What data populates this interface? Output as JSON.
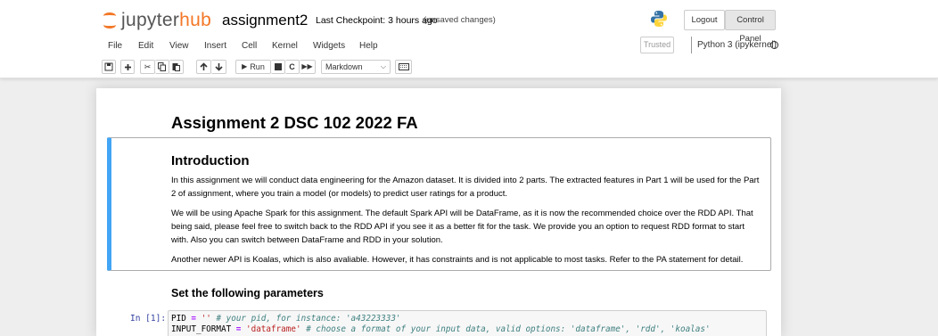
{
  "header": {
    "logo_a": "jupyter",
    "logo_b": "hub",
    "notebook_name": "assignment2",
    "checkpoint": "Last Checkpoint: 3 hours ago",
    "save_status": "(unsaved changes)",
    "logout_label": "Logout",
    "control_panel_label": "Control Panel"
  },
  "menubar": {
    "items": [
      "File",
      "Edit",
      "View",
      "Insert",
      "Cell",
      "Kernel",
      "Widgets",
      "Help"
    ],
    "trusted": "Trusted",
    "kernel": "Python 3 (ipykernel)"
  },
  "toolbar": {
    "run_label": "Run",
    "cell_type": "Markdown",
    "icons": [
      "save-icon",
      "add-icon",
      "cut-icon",
      "copy-icon",
      "paste-icon",
      "move-up-icon",
      "move-down-icon",
      "run-icon",
      "stop-icon",
      "restart-icon",
      "fast-forward-icon",
      "keyboard-icon"
    ]
  },
  "notebook": {
    "title": "Assignment 2 DSC 102 2022 FA",
    "intro_heading": "Introduction",
    "para1_line1": "In this assignment we will conduct data engineering for the Amazon dataset. It is divided into 2 parts. The extracted features in Part 1 will be used for the Part",
    "para1_line2": "2 of assignment, where you train a model (or models) to predict user ratings for a product.",
    "para2_line1": "We will be using Apache Spark for this assignment. The default Spark API will be DataFrame, as it is now the recommended choice over the RDD API. That",
    "para2_line2": "being said, please feel free to switch back to the RDD API if you see it as a better fit for the task. We provide you an option to request RDD format to start",
    "para2_line3": "with. Also you can switch between DataFrame and RDD in your solution.",
    "para3": "Another newer API is Koalas, which is also avaliable. However, it has constraints and is not applicable to most tasks. Refer to the PA statement for detail.",
    "params_heading": "Set the following parameters",
    "prompt": "In [1]:",
    "code": {
      "l1_var": "PID",
      "l1_op": "=",
      "l1_str": "''",
      "l1_comment": "# your pid, for instance: 'a43223333'",
      "l2_var": "INPUT_FORMAT",
      "l2_op": "=",
      "l2_str": "'dataframe'",
      "l2_comment": "# choose a format of your input data, valid options: 'dataframe', 'rdd', 'koalas'"
    }
  },
  "colors": {
    "jupyter_orange": "#f37726",
    "selected_cell_border": "#42a5f5",
    "prompt_blue": "#303f9f"
  }
}
